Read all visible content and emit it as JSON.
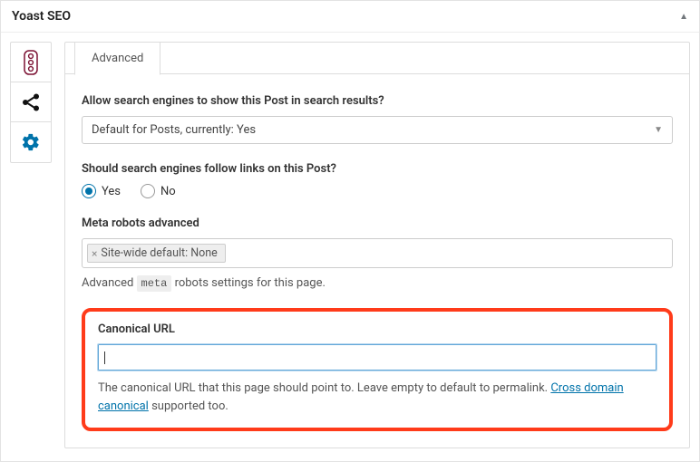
{
  "panel": {
    "title": "Yoast SEO"
  },
  "tabs": {
    "advanced": "Advanced"
  },
  "fields": {
    "allowSearch": {
      "label": "Allow search engines to show this Post in search results?",
      "value": "Default for Posts, currently: Yes"
    },
    "followLinks": {
      "label": "Should search engines follow links on this Post?",
      "options": {
        "yes": "Yes",
        "no": "No"
      },
      "selected": "yes"
    },
    "metaRobots": {
      "label": "Meta robots advanced",
      "chip": "Site-wide default: None",
      "help_pre": "Advanced ",
      "help_code": "meta",
      "help_post": " robots settings for this page."
    },
    "canonical": {
      "label": "Canonical URL",
      "value": "",
      "desc_pre": "The canonical URL that this page should point to. Leave empty to default to permalink. ",
      "link": "Cross domain canonical",
      "desc_post": " supported too."
    }
  }
}
